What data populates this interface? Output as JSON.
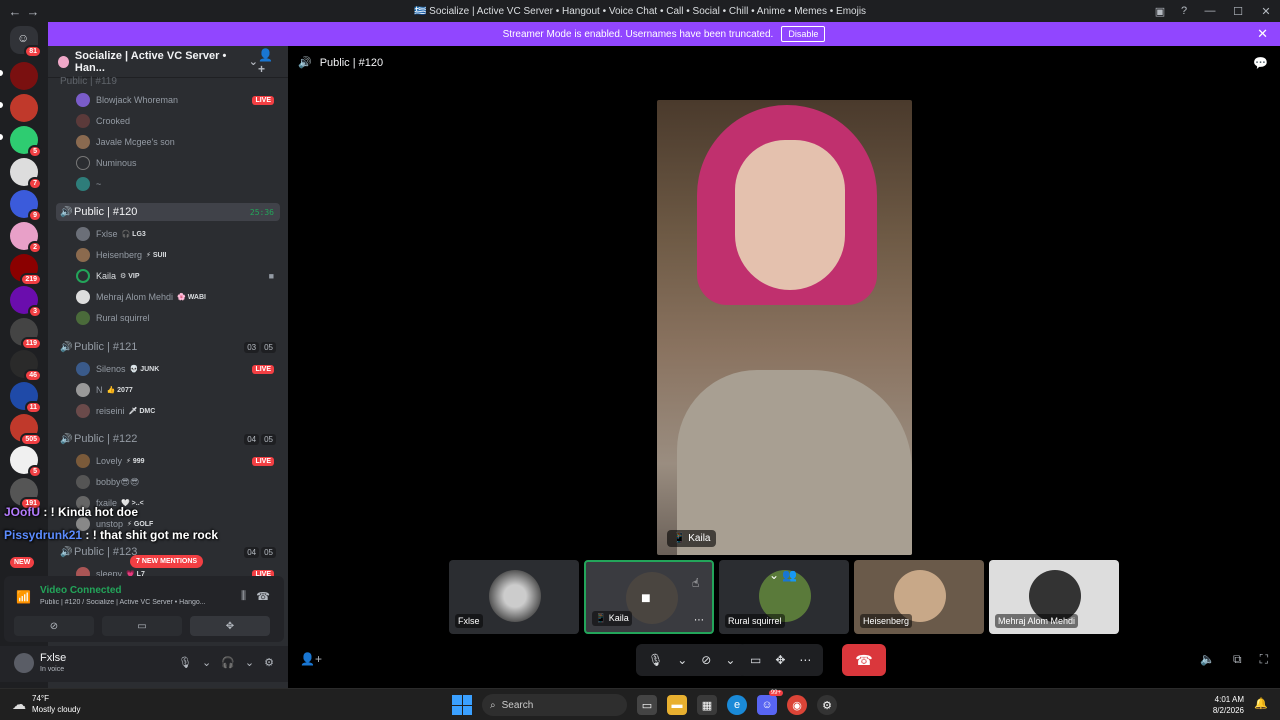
{
  "window": {
    "title": "🇬🇷 Socialize | Active VC Server • Hangout • Voice Chat • Call • Social • Chill • Anime • Memes • Emojis",
    "back_icon": "←",
    "forward_icon": "→"
  },
  "banner": {
    "text": "Streamer Mode is enabled. Usernames have been truncated.",
    "button": "Disable"
  },
  "rail": {
    "home_badge": "81",
    "badges": [
      "5",
      "7",
      "9",
      "2",
      "219",
      "3",
      "119",
      "46",
      "11",
      "505",
      "5",
      "191"
    ],
    "new_label": "NEW"
  },
  "server": {
    "name": "Socialize | Active VC Server • Han...",
    "collapsed_channel": "Public | #119"
  },
  "sidebar": {
    "top_users": [
      {
        "name": "Blowjack Whoreman",
        "live": "LIVE"
      },
      {
        "name": "Crooked"
      },
      {
        "name": "Javale Mcgee's son"
      },
      {
        "name": "Numinous"
      },
      {
        "name": "~"
      }
    ],
    "ch120": {
      "name": "Public | #120",
      "timer": "25:36"
    },
    "ch120_users": [
      {
        "name": "Fxlse",
        "tag": "🎧 LG3"
      },
      {
        "name": "Heisenberg",
        "tag": "⚡ SUII"
      },
      {
        "name": "Kaila",
        "tag": "⚙ VIP"
      },
      {
        "name": "Mehraj Alom Mehdi",
        "tag": "🌸 WABI"
      },
      {
        "name": "Rural squirrel"
      }
    ],
    "ch121": {
      "name": "Public | #121",
      "c1": "03",
      "c2": "05"
    },
    "ch121_users": [
      {
        "name": "Silenos",
        "tag": "💀 JUNK",
        "live": "LIVE"
      },
      {
        "name": "N",
        "tag": "👍 2077"
      },
      {
        "name": "reiseini",
        "tag": "🗡 DMC"
      }
    ],
    "ch122": {
      "name": "Public | #122",
      "c1": "04",
      "c2": "05"
    },
    "ch122_users": [
      {
        "name": "Lovely",
        "tag": "⚡ 999",
        "live": "LIVE"
      },
      {
        "name": "bobby😎😎"
      },
      {
        "name": "fxaile",
        "tag": "🤍 >..<"
      },
      {
        "name": "unstop",
        "tag": "⚡ GOLF"
      }
    ],
    "ch123": {
      "name": "Public | #123",
      "c1": "04",
      "c2": "05"
    },
    "ch123_users": [
      {
        "name": "sleepy",
        "tag": "💗 L7",
        "live": "LIVE"
      }
    ],
    "mentions": "7 NEW MENTIONS"
  },
  "overlay_chat": [
    {
      "name": "JOofU",
      "message": ": ! Kinda hot doe"
    },
    {
      "name": "Pissydrunk21",
      "message": ": ! that shit got me rock"
    }
  ],
  "voice_panel": {
    "status": "Video Connected",
    "location": "Public | #120 / Socialize | Active VC Server • Hango..."
  },
  "user_panel": {
    "name": "Fxlse",
    "status": "In voice"
  },
  "call": {
    "channel": "Public | #120",
    "main_video_label": "Kaila",
    "tiles": [
      {
        "name": "Fxlse"
      },
      {
        "name": "Kaila"
      },
      {
        "name": "Rural squirrel"
      },
      {
        "name": "Heisenberg"
      },
      {
        "name": "Mehraj Alom Mehdi"
      }
    ]
  },
  "taskbar": {
    "temp": "74°F",
    "weather": "Mostly cloudy",
    "search": "Search",
    "time": "4:01 AM",
    "date": "8/2/2026",
    "discord_badge": "99+"
  },
  "colors": {
    "banner": "#9146ff",
    "online": "#23a55a",
    "live": "#f23f43",
    "end_call": "#da373c"
  }
}
